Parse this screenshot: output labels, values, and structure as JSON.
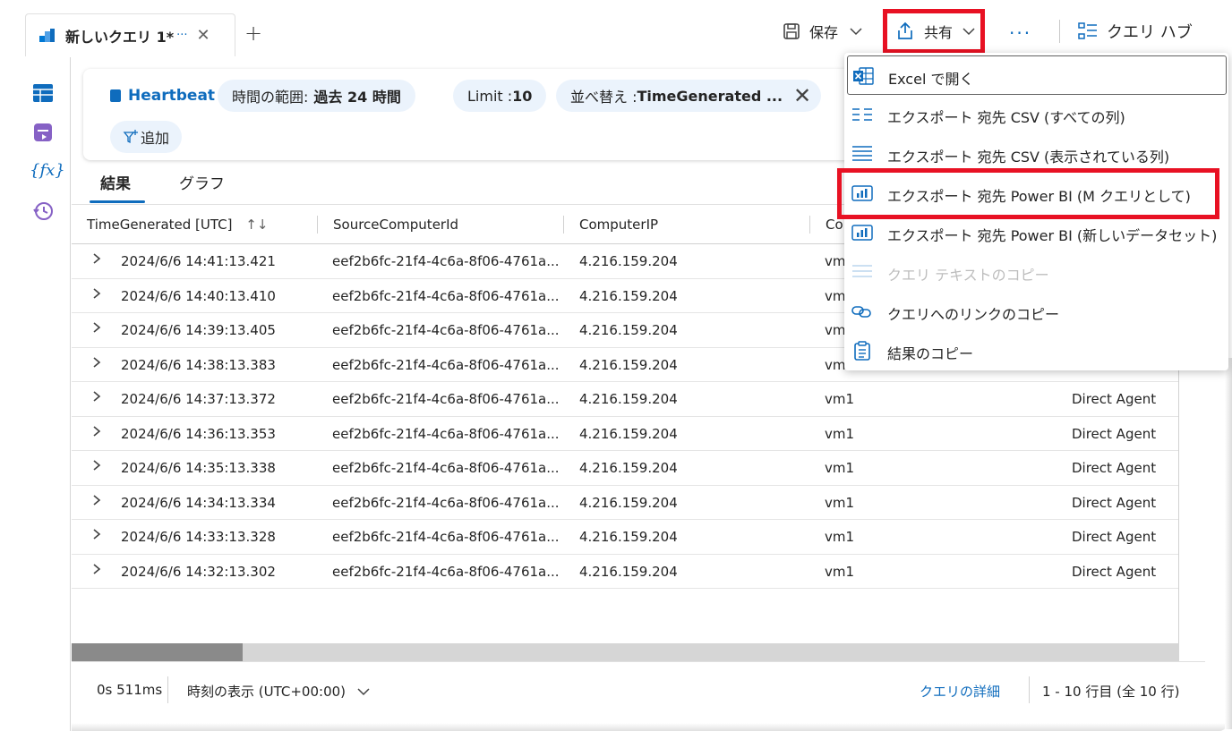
{
  "tab": {
    "title": "新しいクエリ 1*",
    "dots": "···",
    "close": "✕",
    "add": "+"
  },
  "toolbar": {
    "save_label": "保存",
    "share_label": "共有",
    "more_label": "···",
    "hub_label": "クエリ ハブ"
  },
  "query": {
    "table_name": "Heartbeat",
    "time_range_label": "時間の範囲: ",
    "time_range_value": "過去 24 時間",
    "limit_label": "Limit : ",
    "limit_value": "10",
    "sort_label": "並べ替え : ",
    "sort_value": "TimeGenerated ...",
    "add_label": "追加"
  },
  "result_tabs": {
    "results": "結果",
    "chart": "グラフ"
  },
  "columns": [
    "TimeGenerated [UTC]",
    "SourceComputerId",
    "ComputerIP",
    "Co"
  ],
  "rows": [
    {
      "time": "2024/6/6 14:41:13.421",
      "source": "eef2b6fc-21f4-4c6a-8f06-4761a...",
      "ip": "4.216.159.204",
      "computer": "vm",
      "category": ""
    },
    {
      "time": "2024/6/6 14:40:13.410",
      "source": "eef2b6fc-21f4-4c6a-8f06-4761a...",
      "ip": "4.216.159.204",
      "computer": "vm",
      "category": ""
    },
    {
      "time": "2024/6/6 14:39:13.405",
      "source": "eef2b6fc-21f4-4c6a-8f06-4761a...",
      "ip": "4.216.159.204",
      "computer": "vm",
      "category": ""
    },
    {
      "time": "2024/6/6 14:38:13.383",
      "source": "eef2b6fc-21f4-4c6a-8f06-4761a...",
      "ip": "4.216.159.204",
      "computer": "vm",
      "category": ""
    },
    {
      "time": "2024/6/6 14:37:13.372",
      "source": "eef2b6fc-21f4-4c6a-8f06-4761a...",
      "ip": "4.216.159.204",
      "computer": "vm1",
      "category": "Direct Agent"
    },
    {
      "time": "2024/6/6 14:36:13.353",
      "source": "eef2b6fc-21f4-4c6a-8f06-4761a...",
      "ip": "4.216.159.204",
      "computer": "vm1",
      "category": "Direct Agent"
    },
    {
      "time": "2024/6/6 14:35:13.338",
      "source": "eef2b6fc-21f4-4c6a-8f06-4761a...",
      "ip": "4.216.159.204",
      "computer": "vm1",
      "category": "Direct Agent"
    },
    {
      "time": "2024/6/6 14:34:13.334",
      "source": "eef2b6fc-21f4-4c6a-8f06-4761a...",
      "ip": "4.216.159.204",
      "computer": "vm1",
      "category": "Direct Agent"
    },
    {
      "time": "2024/6/6 14:33:13.328",
      "source": "eef2b6fc-21f4-4c6a-8f06-4761a...",
      "ip": "4.216.159.204",
      "computer": "vm1",
      "category": "Direct Agent"
    },
    {
      "time": "2024/6/6 14:32:13.302",
      "source": "eef2b6fc-21f4-4c6a-8f06-4761a...",
      "ip": "4.216.159.204",
      "computer": "vm1",
      "category": "Direct Agent"
    }
  ],
  "footer": {
    "duration": "0s 511ms",
    "timezone": "時刻の表示 (UTC+00:00)",
    "details_link": "クエリの詳細",
    "row_count": "1 - 10 行目 (全 10 行)"
  },
  "share_menu": {
    "items": [
      {
        "label": "Excel で開く",
        "icon": "excel-icon"
      },
      {
        "label": "エクスポート 宛先 CSV (すべての列)",
        "icon": "csv-all-icon"
      },
      {
        "label": "エクスポート 宛先 CSV (表示されている列)",
        "icon": "csv-visible-icon"
      },
      {
        "label": "エクスポート 宛先 Power BI (M クエリとして)",
        "icon": "powerbi-icon"
      },
      {
        "label": "エクスポート 宛先 Power BI (新しいデータセット)",
        "icon": "powerbi-icon"
      },
      {
        "label": "クエリ テキストのコピー",
        "icon": "copy-text-icon"
      },
      {
        "label": "クエリへのリンクのコピー",
        "icon": "link-icon"
      },
      {
        "label": "結果のコピー",
        "icon": "clipboard-icon"
      }
    ]
  },
  "colors": {
    "accent": "#0f6cbd",
    "highlight": "#e81123",
    "chip_bg": "#ebf3fc"
  }
}
